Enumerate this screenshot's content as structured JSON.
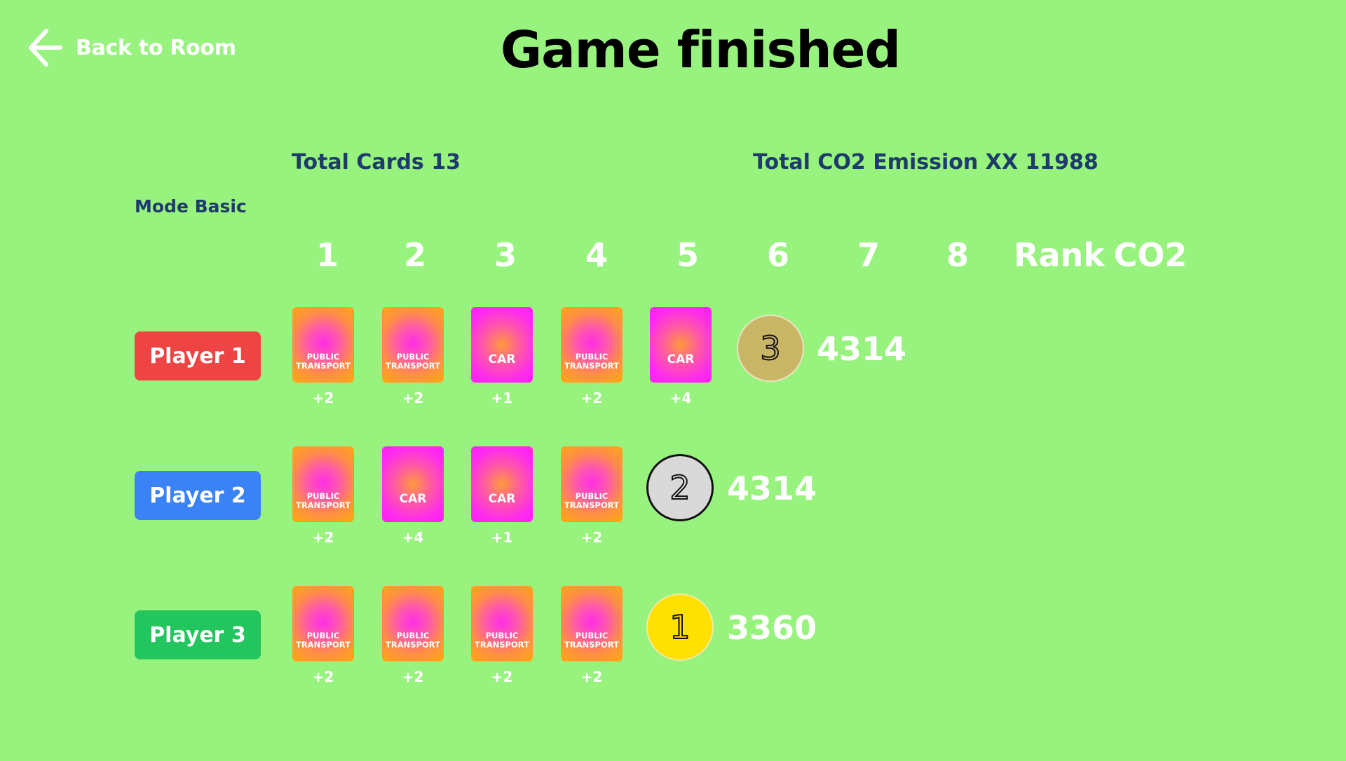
{
  "header": {
    "back_label": "Back to Room",
    "title": "Game finished"
  },
  "stats": {
    "total_cards": "Total Cards 13",
    "total_co2": "Total CO2 Emission XX 11988",
    "mode": "Mode Basic"
  },
  "columns": [
    "1",
    "2",
    "3",
    "4",
    "5",
    "6",
    "7",
    "8",
    "Rank",
    "CO2"
  ],
  "players": [
    {
      "name": "Player 1",
      "color": "#ef4444",
      "cards": [
        {
          "type": "pt",
          "label": "PUBLIC TRANSPORT",
          "score": "+2"
        },
        {
          "type": "pt",
          "label": "PUBLIC TRANSPORT",
          "score": "+2"
        },
        {
          "type": "car",
          "label": "CAR",
          "score": "+1"
        },
        {
          "type": "pt",
          "label": "PUBLIC TRANSPORT",
          "score": "+2"
        },
        {
          "type": "car",
          "label": "CAR",
          "score": "+4"
        }
      ],
      "rank": "3",
      "rank_color": "#c9b566",
      "co2": "4314"
    },
    {
      "name": "Player 2",
      "color": "#3b82f6",
      "cards": [
        {
          "type": "pt",
          "label": "PUBLIC TRANSPORT",
          "score": "+2"
        },
        {
          "type": "car",
          "label": "CAR",
          "score": "+4"
        },
        {
          "type": "car",
          "label": "CAR",
          "score": "+1"
        },
        {
          "type": "pt",
          "label": "PUBLIC TRANSPORT",
          "score": "+2"
        }
      ],
      "rank": "2",
      "rank_color": "#d9d9d9",
      "co2": "4314"
    },
    {
      "name": "Player 3",
      "color": "#22c55e",
      "cards": [
        {
          "type": "pt",
          "label": "PUBLIC TRANSPORT",
          "score": "+2"
        },
        {
          "type": "pt",
          "label": "PUBLIC TRANSPORT",
          "score": "+2"
        },
        {
          "type": "pt",
          "label": "PUBLIC TRANSPORT",
          "score": "+2"
        },
        {
          "type": "pt",
          "label": "PUBLIC TRANSPORT",
          "score": "+2"
        }
      ],
      "rank": "1",
      "rank_color": "#ffe000",
      "co2": "3360"
    }
  ]
}
